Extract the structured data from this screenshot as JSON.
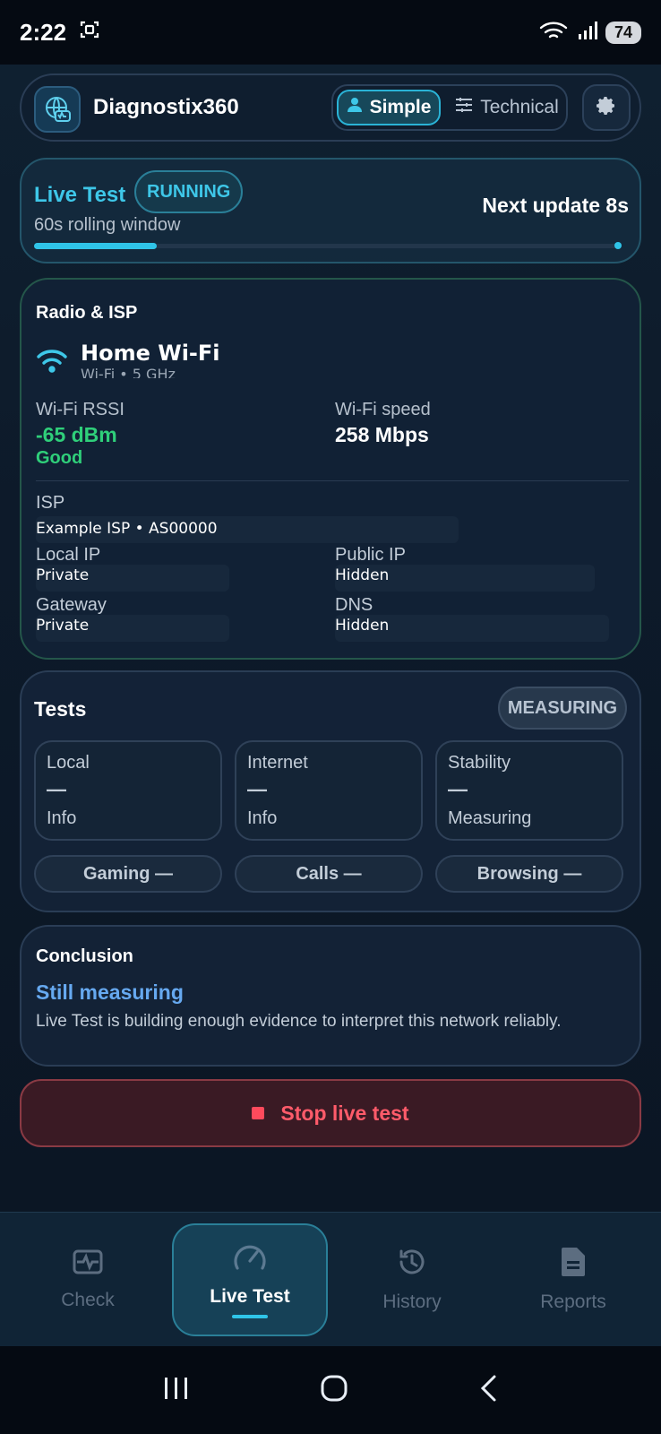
{
  "status_bar": {
    "time": "2:22",
    "battery": "74"
  },
  "header": {
    "app_name": "Diagnostix360",
    "mode_simple": "Simple",
    "mode_technical": "Technical"
  },
  "live": {
    "title": "Live Test",
    "badge": "RUNNING",
    "subtitle": "60s rolling window",
    "next_update": "Next update 8s",
    "progress": 0.21
  },
  "radio": {
    "section": "Radio & ISP",
    "network_name": "Home Wi-Fi",
    "network_band": "Wi-Fi • 5 GHz",
    "rssi_label": "Wi-Fi RSSI",
    "rssi_value": "-65 dBm",
    "rssi_quality": "Good",
    "speed_label": "Wi-Fi speed",
    "speed_value": "258 Mbps",
    "isp_label": "ISP",
    "isp_value": "Example ISP • AS00000",
    "local_ip_label": "Local IP",
    "local_ip_value": "Private",
    "public_ip_label": "Public IP",
    "public_ip_value": "Hidden",
    "gateway_label": "Gateway",
    "gateway_value": "Private",
    "dns_label": "DNS",
    "dns_value": "Hidden",
    "colors": {
      "good": "#2fcf7a",
      "accent": "#3ec7e8"
    }
  },
  "tests": {
    "title": "Tests",
    "badge": "MEASURING",
    "tiles": [
      {
        "name": "Local",
        "value": "—",
        "status": "Info"
      },
      {
        "name": "Internet",
        "value": "—",
        "status": "Info"
      },
      {
        "name": "Stability",
        "value": "—",
        "status": "Measuring"
      }
    ],
    "pills": [
      "Gaming —",
      "Calls —",
      "Browsing —"
    ]
  },
  "conclusion": {
    "label": "Conclusion",
    "headline": "Still measuring",
    "text": "Live Test is building enough evidence to interpret this network reliably."
  },
  "stop_button": {
    "label": "Stop live test"
  },
  "nav": {
    "items": [
      {
        "label": "Check",
        "icon": "pulse-icon"
      },
      {
        "label": "Live Test",
        "icon": "gauge-icon"
      },
      {
        "label": "History",
        "icon": "history-icon"
      },
      {
        "label": "Reports",
        "icon": "document-icon"
      }
    ]
  }
}
